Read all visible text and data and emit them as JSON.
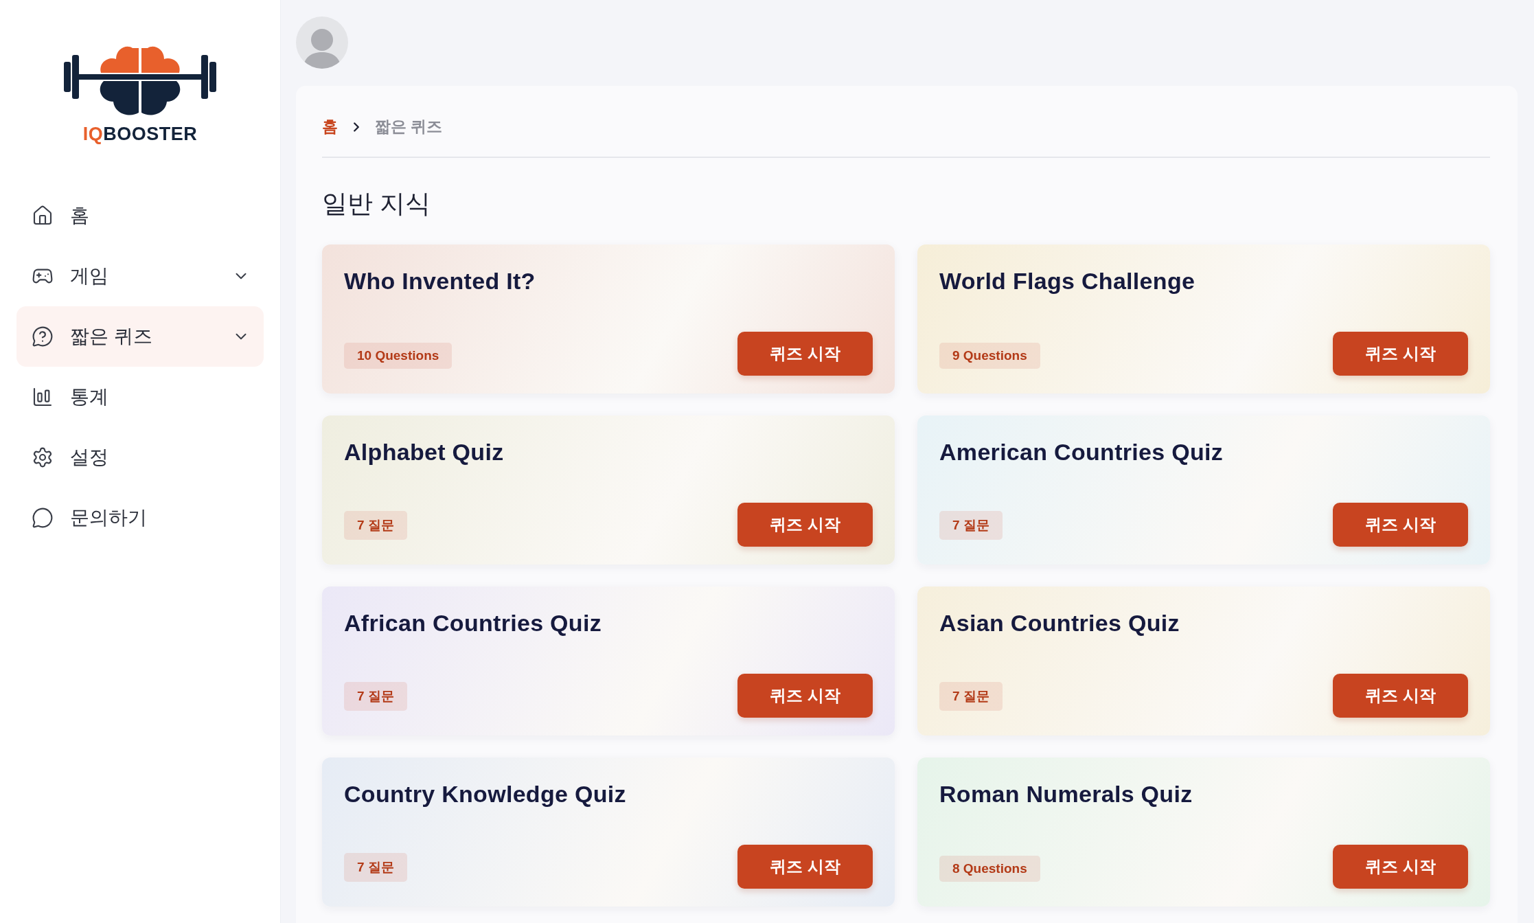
{
  "logo": {
    "prefix": "IQ",
    "name": "BOOSTER"
  },
  "sidebar": {
    "items": [
      {
        "label": "홈",
        "kind": "home",
        "expandable": false,
        "selected": false
      },
      {
        "label": "게임",
        "kind": "game",
        "expandable": true,
        "selected": false
      },
      {
        "label": "짧은 퀴즈",
        "kind": "quiz",
        "expandable": true,
        "selected": true
      },
      {
        "label": "통계",
        "kind": "stats",
        "expandable": false,
        "selected": false
      },
      {
        "label": "설정",
        "kind": "settings",
        "expandable": false,
        "selected": false
      },
      {
        "label": "문의하기",
        "kind": "contact",
        "expandable": false,
        "selected": false
      }
    ]
  },
  "breadcrumb": [
    "홈",
    "짧은 퀴즈"
  ],
  "section_title": "일반 지식",
  "cards": [
    {
      "title": "Who Invented It?",
      "count": "10 Questions",
      "button": "퀴즈 시작",
      "color": "#f3e2dc"
    },
    {
      "title": "World Flags Challenge",
      "count": "9 Questions",
      "button": "퀴즈 시작",
      "color": "#f6eed8"
    },
    {
      "title": "Alphabet Quiz",
      "count": "7 질문",
      "button": "퀴즈 시작",
      "color": "#efeee0"
    },
    {
      "title": "American Countries Quiz",
      "count": "7 질문",
      "button": "퀴즈 시작",
      "color": "#e8f3f7"
    },
    {
      "title": "African Countries Quiz",
      "count": "7 질문",
      "button": "퀴즈 시작",
      "color": "#ebe8f7"
    },
    {
      "title": "Asian Countries Quiz",
      "count": "7 질문",
      "button": "퀴즈 시작",
      "color": "#f6efdc"
    },
    {
      "title": "Country Knowledge Quiz",
      "count": "7 질문",
      "button": "퀴즈 시작",
      "color": "#e6ecf5"
    },
    {
      "title": "Roman Numerals Quiz",
      "count": "8 Questions",
      "button": "퀴즈 시작",
      "color": "#e6f4ea"
    }
  ]
}
